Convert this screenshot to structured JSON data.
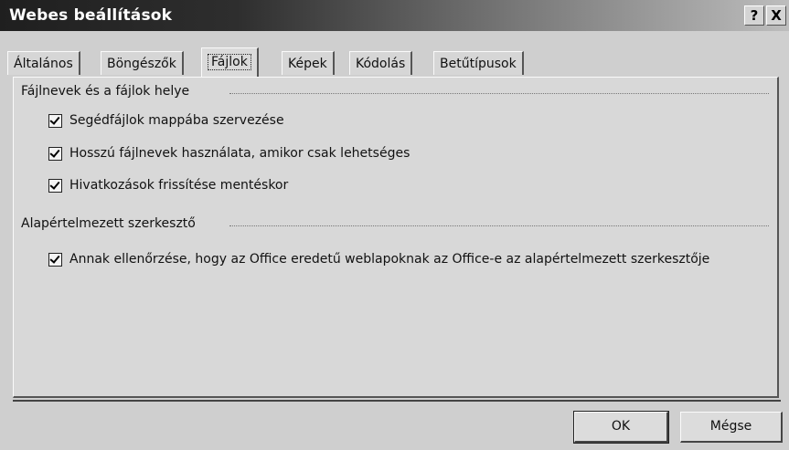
{
  "window": {
    "title": "Webes beállítások",
    "help_label": "?",
    "close_label": "X"
  },
  "tabs": [
    {
      "label": "Általános",
      "active": false
    },
    {
      "label": "Böngészők",
      "active": false
    },
    {
      "label": "Fájlok",
      "active": true
    },
    {
      "label": "Képek",
      "active": false
    },
    {
      "label": "Kódolás",
      "active": false
    },
    {
      "label": "Betűtípusok",
      "active": false
    }
  ],
  "groups": {
    "files": {
      "label": "Fájlnevek és a fájlok helye",
      "options": [
        {
          "label": "Segédfájlok mappába szervezése",
          "checked": true
        },
        {
          "label": "Hosszú fájlnevek használata, amikor csak lehetséges",
          "checked": true
        },
        {
          "label": "Hivatkozások frissítése mentéskor",
          "checked": true
        }
      ]
    },
    "default_editor": {
      "label": "Alapértelmezett szerkesztő",
      "options": [
        {
          "label": "Annak ellenőrzése, hogy az Office eredetű weblapoknak az Office-e az alapértelmezett szerkesztője",
          "checked": true
        }
      ]
    }
  },
  "buttons": {
    "ok": "OK",
    "cancel": "Mégse"
  }
}
